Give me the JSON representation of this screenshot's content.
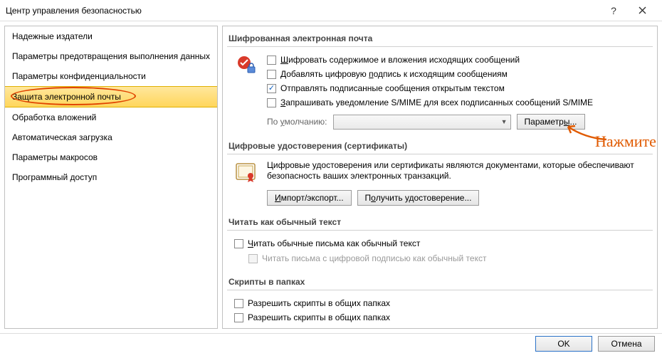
{
  "window": {
    "title": "Центр управления безопасностью"
  },
  "sidebar": {
    "items": [
      {
        "label": "Надежные издатели",
        "selected": false
      },
      {
        "label": "Параметры предотвращения выполнения данных",
        "selected": false
      },
      {
        "label": "Параметры конфиденциальности",
        "selected": false
      },
      {
        "label": "Защита электронной почты",
        "selected": true
      },
      {
        "label": "Обработка вложений",
        "selected": false
      },
      {
        "label": "Автоматическая загрузка",
        "selected": false
      },
      {
        "label": "Параметры макросов",
        "selected": false
      },
      {
        "label": "Программный доступ",
        "selected": false
      }
    ]
  },
  "sections": {
    "encrypted_mail": {
      "header": "Шифрованная электронная почта",
      "opt_encrypt": "Шифровать содержимое и вложения исходящих сообщений",
      "opt_sign": "Добавлять цифровую подпись к исходящим сообщениям",
      "opt_cleartext": "Отправлять подписанные сообщения открытым текстом",
      "opt_receipt": "Запрашивать уведомление S/MIME для всех подписанных сообщений S/MIME",
      "default_label": "По умолчанию:",
      "params_btn": "Параметры..."
    },
    "certs": {
      "header": "Цифровые удостоверения (сертификаты)",
      "text": "Цифровые удостоверения или сертификаты являются документами, которые обеспечивают безопасность ваших электронных транзакций.",
      "import_btn": "Импорт/экспорт...",
      "get_btn": "Получить удостоверение..."
    },
    "plaintext": {
      "header": "Читать как обычный текст",
      "opt_plain": "Читать обычные письма как обычный текст",
      "opt_signed_plain": "Читать письма с цифровой подписью как обычный текст"
    },
    "scripts": {
      "header": "Скрипты в папках",
      "opt_shared": "Разрешить скрипты в общих папках",
      "opt_shared2": "Разрешить скрипты в общих папках"
    }
  },
  "footer": {
    "ok": "OK",
    "cancel": "Отмена"
  },
  "annotation": {
    "text": "Нажмите"
  },
  "checkbox_state": {
    "encrypt": false,
    "sign": false,
    "cleartext": true,
    "receipt": false,
    "plain": false,
    "signed_plain_disabled": true,
    "scripts_shared": false,
    "scripts_shared2": false
  }
}
